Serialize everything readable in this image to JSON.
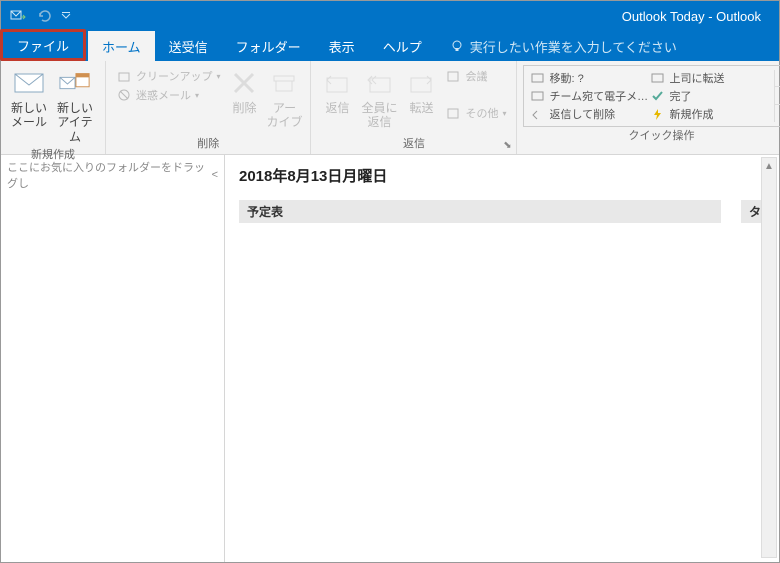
{
  "titlebar": {
    "title": "Outlook Today  -  Outlook"
  },
  "tabs": {
    "file": "ファイル",
    "home": "ホーム",
    "sendrecv": "送受信",
    "folder": "フォルダー",
    "view": "表示",
    "help": "ヘルプ",
    "tellme": "実行したい作業を入力してください"
  },
  "ribbon": {
    "new_group": "新規作成",
    "new_mail": "新しい\nメール",
    "new_item": "新しい\nアイテム",
    "delete_group": "削除",
    "cleanup": "クリーンアップ",
    "junk": "迷惑メール",
    "delete": "削除",
    "archive": "アー\nカイブ",
    "reply_group": "返信",
    "reply": "返信",
    "reply_all": "全員に\n返信",
    "forward": "転送",
    "meeting": "会議",
    "more": "その他",
    "quick_group": "クイック操作",
    "move_to": "移動: ?",
    "team_mail": "チーム宛て電子メ…",
    "reply_delete": "返信して削除",
    "to_boss": "上司に転送",
    "done": "完了",
    "new_quick": "新規作成"
  },
  "nav": {
    "hint": "ここにお気に入りのフォルダーをドラッグし"
  },
  "main": {
    "date": "2018年8月13日月曜日",
    "calendar": "予定表",
    "tasks": "タ"
  }
}
